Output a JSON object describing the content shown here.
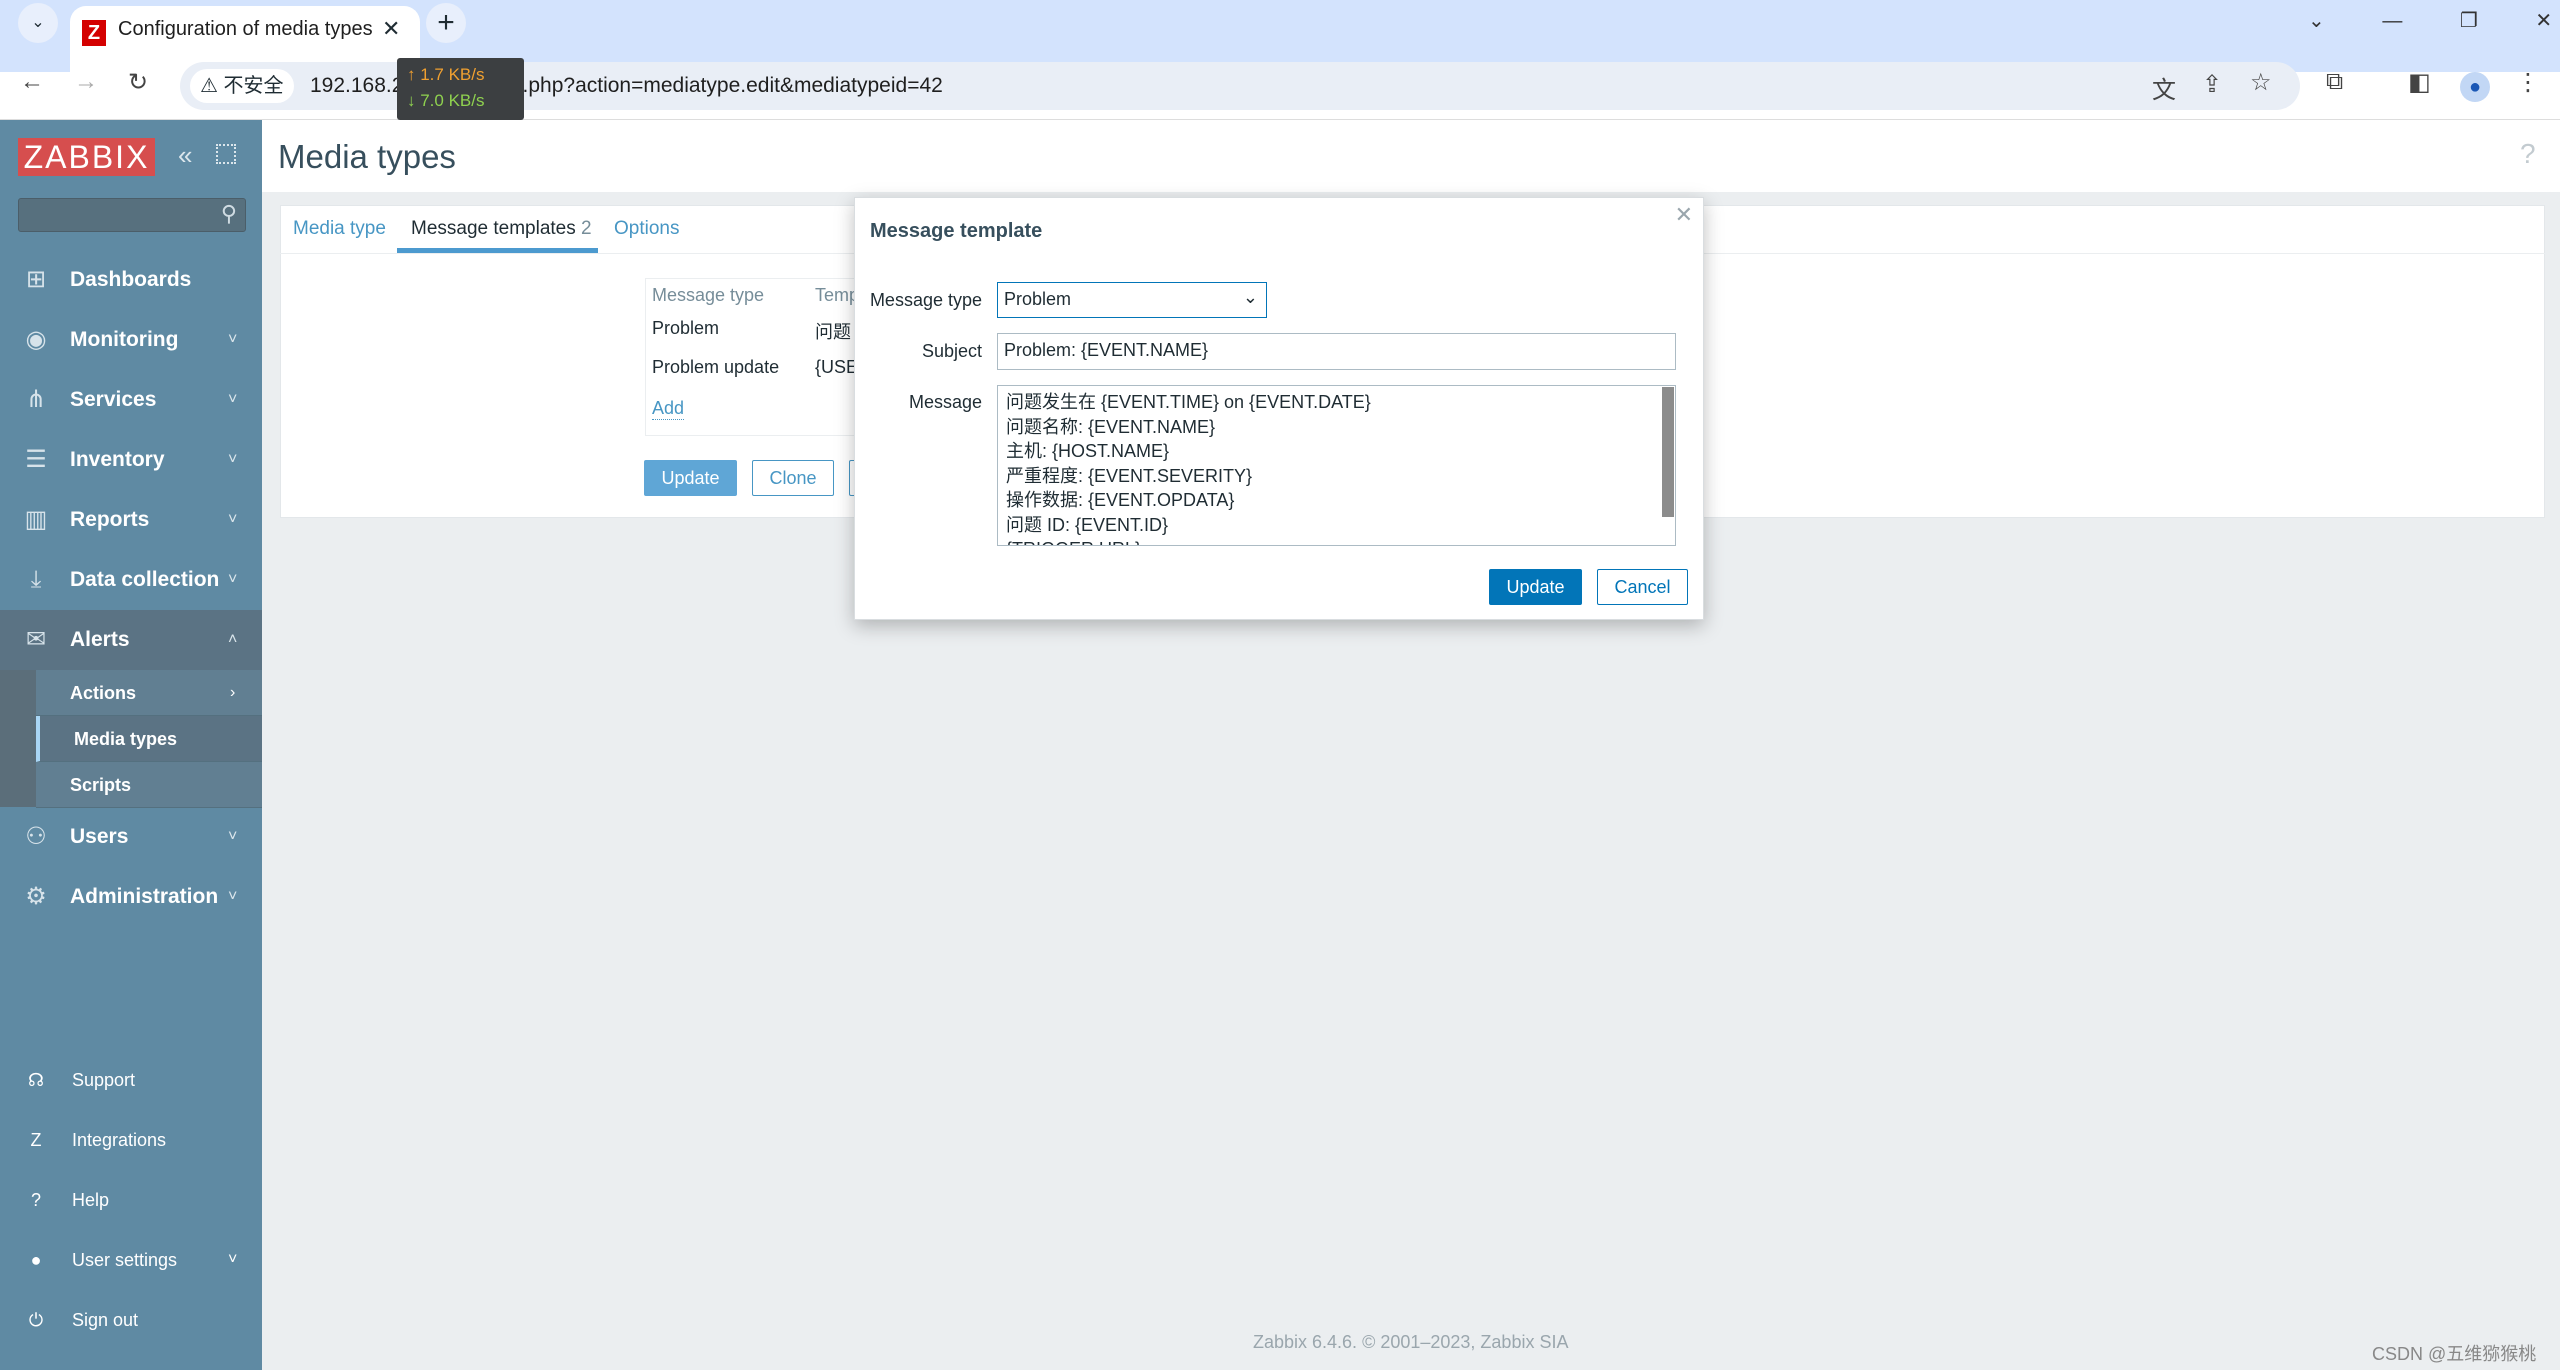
{
  "browser": {
    "tab_title": "Configuration of media types",
    "favicon": "Z",
    "insecure_label": "不安全",
    "url": "192.168.234.33/zabbix.php?action=mediatype.edit&mediatypeid=42",
    "upload_speed": "↑ 1.7 KB/s",
    "download_speed": "↓ 7.0 KB/s"
  },
  "sidebar": {
    "logo": "ZABBIX",
    "items": [
      {
        "label": "Dashboards",
        "icon": "dashboard-icon"
      },
      {
        "label": "Monitoring",
        "icon": "eye-icon"
      },
      {
        "label": "Services",
        "icon": "hierarchy-icon"
      },
      {
        "label": "Inventory",
        "icon": "list-icon"
      },
      {
        "label": "Reports",
        "icon": "report-icon"
      },
      {
        "label": "Data collection",
        "icon": "download-icon"
      },
      {
        "label": "Alerts",
        "icon": "envelope-icon"
      },
      {
        "label": "Users",
        "icon": "users-icon"
      },
      {
        "label": "Administration",
        "icon": "gear-icon"
      }
    ],
    "alerts_sub": [
      "Actions",
      "Media types",
      "Scripts"
    ],
    "bottom": [
      {
        "label": "Support",
        "icon": "headset-icon"
      },
      {
        "label": "Integrations",
        "icon": "z-icon"
      },
      {
        "label": "Help",
        "icon": "question-icon"
      },
      {
        "label": "User settings",
        "icon": "user-icon"
      },
      {
        "label": "Sign out",
        "icon": "power-icon"
      }
    ]
  },
  "page": {
    "title": "Media types",
    "tabs": [
      "Media type",
      "Message templates",
      "Options"
    ],
    "tab_count": "2",
    "list": {
      "col1": "Message type",
      "col2": "Temp",
      "rows": [
        {
          "type": "Problem",
          "template": "问题"
        },
        {
          "type": "Problem update",
          "template": "{USE"
        }
      ],
      "add": "Add"
    },
    "buttons": {
      "update": "Update",
      "clone": "Clone"
    }
  },
  "modal": {
    "title": "Message template",
    "labels": {
      "type": "Message type",
      "subject": "Subject",
      "message": "Message"
    },
    "message_type": "Problem",
    "subject": "Problem: {EVENT.NAME}",
    "message_lines": [
      "问题发生在 {EVENT.TIME} on {EVENT.DATE}",
      "问题名称: {EVENT.NAME}",
      "主机: {HOST.NAME}",
      "严重程度: {EVENT.SEVERITY}",
      "操作数据: {EVENT.OPDATA}",
      "问题 ID: {EVENT.ID}",
      "{TRIGGER.URL}"
    ],
    "update": "Update",
    "cancel": "Cancel"
  },
  "footer": "Zabbix 6.4.6. © 2001–2023, Zabbix SIA",
  "watermark": "CSDN @五维猕猴桃"
}
